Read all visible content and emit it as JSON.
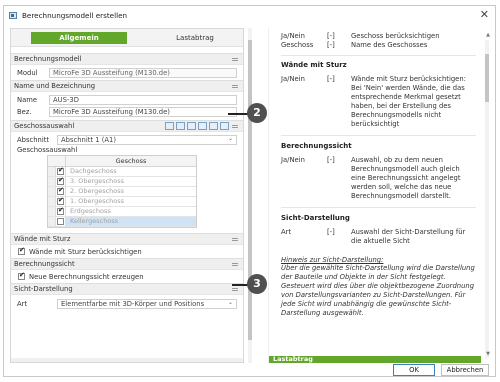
{
  "window": {
    "title": "Berechnungsmodell erstellen",
    "close_glyph": "✕"
  },
  "tabs": {
    "active": "Allgemein",
    "inactive": "Lastabtrag"
  },
  "sections": {
    "berechnungsmodell": "Berechnungsmodell",
    "name": "Name und Bezeichnung",
    "geschossauswahl": "Geschossauswahl",
    "waende": "Wände mit Sturz",
    "sicht": "Berechnungssicht",
    "darstellung": "Sicht-Darstellung"
  },
  "modul": {
    "label": "Modul",
    "value": "MicroFe 3D Aussteifung (M130.de)"
  },
  "name": {
    "label": "Name",
    "value": "AUS-3D"
  },
  "bez": {
    "label": "Bez.",
    "value": "MicroFe 3D Aussteifung (M130.de)"
  },
  "abschnitt": {
    "label": "Abschnitt",
    "value": "Abschnitt 1 (A1)"
  },
  "geschossauswahl_label": "Geschossauswahl",
  "grid": {
    "header": "Geschoss",
    "rows": [
      {
        "name": "Dachgeschoss",
        "checked": true
      },
      {
        "name": "3. Obergeschoss",
        "checked": true
      },
      {
        "name": "2. Obergeschoss",
        "checked": true
      },
      {
        "name": "1. Obergeschoss",
        "checked": true
      },
      {
        "name": "Erdgeschoss",
        "checked": true
      },
      {
        "name": "Kellergeschoss",
        "checked": false
      }
    ]
  },
  "waende_check": "Wände mit Sturz berücksichtigen",
  "sicht_check": "Neue Berechnungssicht erzeugen",
  "art": {
    "label": "Art",
    "value": "Elementfarbe mit 3D-Körper und Positions"
  },
  "help": {
    "top_rows": [
      {
        "k": "Ja/Nein",
        "u": "[-]",
        "d": "Geschoss berücksichtigen"
      },
      {
        "k": "Geschoss",
        "u": "[-]",
        "d": "Name des Geschosses"
      }
    ],
    "h1": "Wände mit Sturz",
    "r1": {
      "k": "Ja/Nein",
      "u": "[-]",
      "d": "Wände mit Sturz berücksichtigen: Bei 'Nein' werden Wände, die das entsprechende Merkmal gesetzt haben, bei der Erstellung des Berechnungsmodells nicht berücksichtigt"
    },
    "h2": "Berechnungssicht",
    "r2": {
      "k": "Ja/Nein",
      "u": "[-]",
      "d": "Auswahl, ob zu dem neuen Berechnungsmodell auch gleich eine Berechnungssicht angelegt werden soll, welche das neue Berechnungsmodell darstellt."
    },
    "h3": "Sicht-Darstellung",
    "r3": {
      "k": "Art",
      "u": "[-]",
      "d": "Auswahl der Sicht-Darstellung für die aktuelle Sicht"
    },
    "hint_title": "Hinweis zur Sicht-Darstellung:",
    "hint_body": "Über die gewählte Sicht-Darstellung wird die Darstellung der Bauteile und Objekte in der Sicht festgelegt. Gesteuert wird dies über die objektbezogene Zuordnung von Darstellungsvarianten zu Sicht-Darstellungen. Für jede Sicht wird unabhängig die gewünschte Sicht-Darstellung ausgewählt.",
    "bar_label": "Lastabtrag"
  },
  "callouts": {
    "two": "2",
    "three": "3"
  },
  "footer": {
    "ok": "OK",
    "cancel": "Abbrechen"
  },
  "colors": {
    "accent_green": "#62a62a",
    "callout": "#505050",
    "selection": "#cfe3f7"
  }
}
